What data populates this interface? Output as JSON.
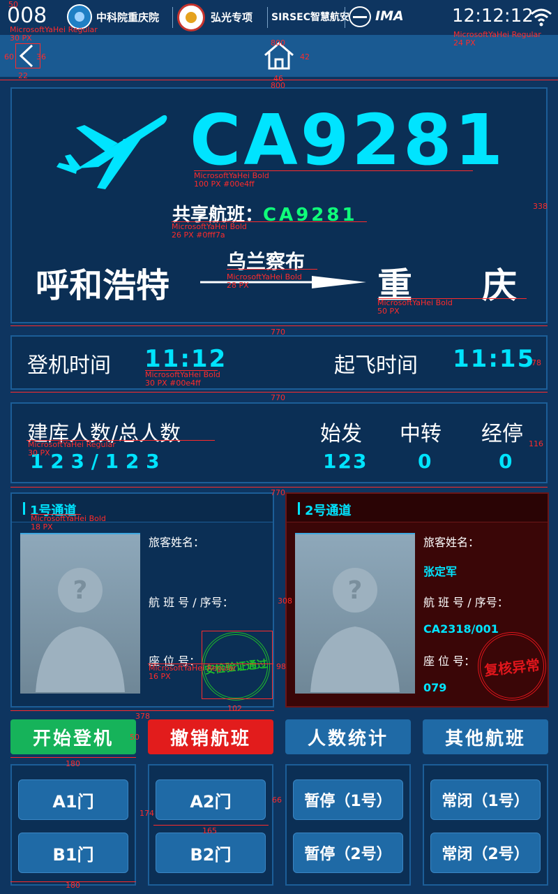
{
  "status": {
    "code": "008",
    "time": "12:12:12",
    "logos": [
      "中科院重庆院",
      "弘光专项",
      "SIRSEC智慧航安",
      "IMA"
    ]
  },
  "flight": {
    "number": "CA9281",
    "shared_label": "共享航班：",
    "shared_number": "CA9281",
    "origin": "呼和浩特",
    "via": "乌兰察布",
    "destination": "重　　庆"
  },
  "times": {
    "boarding_label": "登机时间",
    "boarding_time": "11:12",
    "departure_label": "起飞时间",
    "departure_time": "11:15"
  },
  "counts": {
    "label": "建库人数/总人数",
    "value": "1 2 3 / 1 2 3",
    "origin_label": "始发",
    "origin_value": "123",
    "transfer_label": "中转",
    "transfer_value": "0",
    "stop_label": "经停",
    "stop_value": "0"
  },
  "channels": [
    {
      "title": "1号通道",
      "name_label": "旅客姓名：",
      "name_value": "",
      "flight_label": "航 班 号 / 序号：",
      "flight_value": "",
      "seat_label": "座 位 号：",
      "seat_value": "",
      "stamp": "安检验证通过",
      "stamp_color": "#1fbf2a",
      "bg": "#0b2f55"
    },
    {
      "title": "2号通道",
      "name_label": "旅客姓名：",
      "name_value": "张定军",
      "flight_label": "航 班 号 / 序号：",
      "flight_value": "CA2318/001",
      "seat_label": "座 位 号：",
      "seat_value": "079",
      "stamp": "复核异常",
      "stamp_color": "#e0161c",
      "bg": "#3a0607"
    }
  ],
  "actions": {
    "start": "开始登机",
    "cancel": "撤销航班",
    "stats": "人数统计",
    "other": "其他航班"
  },
  "gates": {
    "a1": "A1门",
    "b1": "B1门",
    "a2": "A2门",
    "b2": "B2门",
    "pause1": "暂停（1号）",
    "pause2": "暂停（2号）",
    "closed1": "常闭（1号）",
    "closed2": "常闭（2号）"
  },
  "annotations": {
    "a_50": "50",
    "a_font1": "MicrosoftYaHei Regular",
    "a_30px": "30 PX",
    "a_font_time": "MicrosoftYaHei Regular",
    "a_24px": "24 PX",
    "a_800a": "800",
    "a_42": "42",
    "a_46": "46",
    "a_800b": "800",
    "a_60": "60",
    "a_36": "36",
    "a_22": "22",
    "a_fb1": "MicrosoftYaHei Bold",
    "a_100px": "100 PX   #00e4ff",
    "a_338": "338",
    "a_fb2": "MicrosoftYaHei Bold",
    "a_26px": "26 PX   #0fff7a",
    "a_fb3": "MicrosoftYaHei Bold",
    "a_28px": "28 PX",
    "a_fb4": "MicrosoftYaHei Bold",
    "a_50px": "50 PX",
    "a_770a": "770",
    "a_fb5": "MicrosoftYaHei Bold",
    "a_30pxc": "30 PX   #00e4ff",
    "a_78": "78",
    "a_770b": "770",
    "a_fr6": "MicrosoftYaHei Regular",
    "a_30pxd": "30 PX",
    "a_116": "116",
    "a_770c": "770",
    "a_fb7": "MicrosoftYaHei Bold",
    "a_18px": "18 PX",
    "a_308": "308",
    "a_fr8": "MicrosoftYaHei Regular",
    "a_16px": "16 PX",
    "a_98": "98",
    "a_102": "102",
    "a_378": "378",
    "a_50b": "50",
    "a_180a": "180",
    "a_174": "174",
    "a_66": "66",
    "a_165": "165",
    "a_180b": "180"
  }
}
